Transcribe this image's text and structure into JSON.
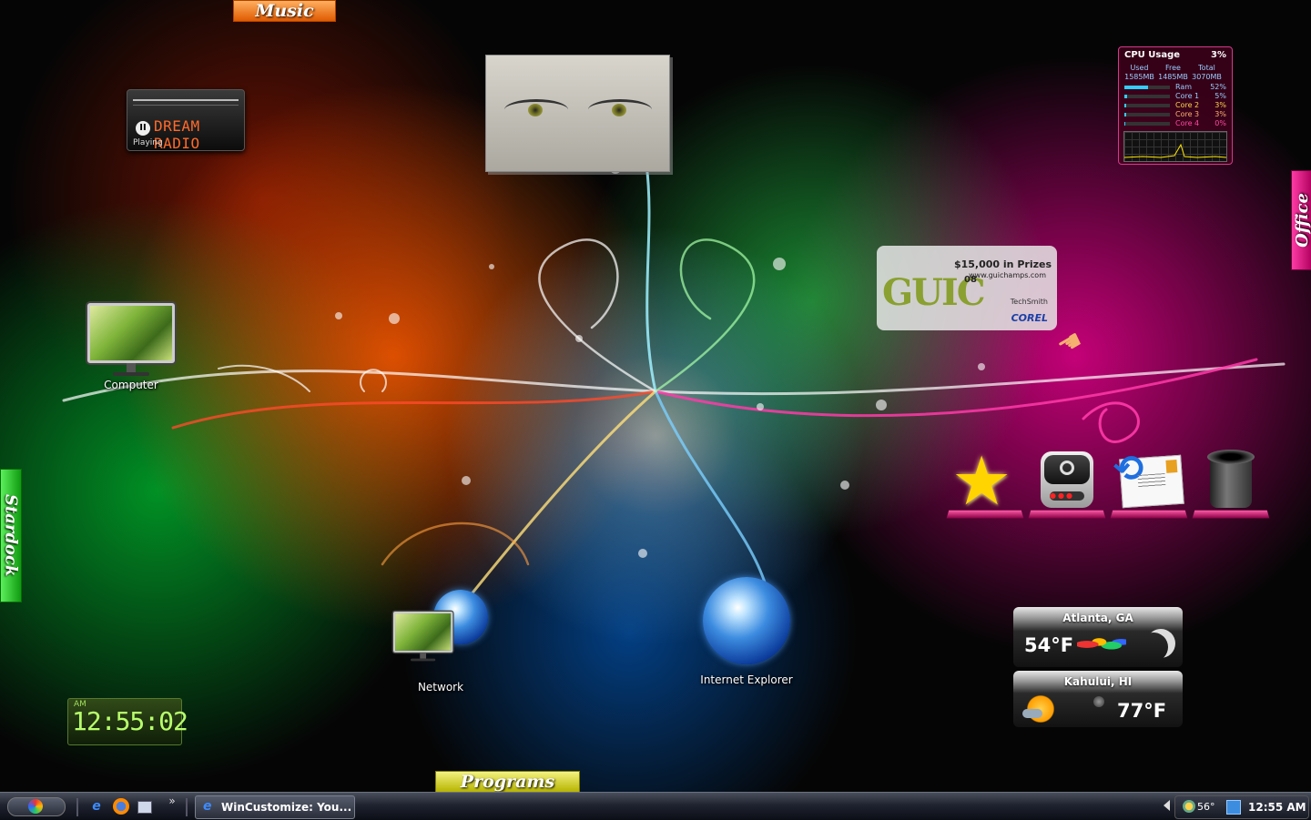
{
  "tabs": {
    "music": "Music",
    "programs": "Programs",
    "stardock": "Stardock",
    "office": "Office"
  },
  "dream_radio": {
    "title": "DREAM RADIO",
    "status": "Playing"
  },
  "cpu_meter": {
    "title": "CPU Usage",
    "total_pct": "3%",
    "col_headers": [
      "Used",
      "Free",
      "Total"
    ],
    "col_values": [
      "1585MB",
      "1485MB",
      "3070MB"
    ],
    "rows": [
      {
        "label": "Ram",
        "value": "52%",
        "level": 0.52
      },
      {
        "label": "Core 1",
        "value": "5%",
        "level": 0.05
      },
      {
        "label": "Core 2",
        "value": "3%",
        "level": 0.03
      },
      {
        "label": "Core 3",
        "value": "3%",
        "level": 0.03
      },
      {
        "label": "Core 4",
        "value": "0%",
        "level": 0.0
      }
    ]
  },
  "ad": {
    "logo": "GUIC",
    "year": "08",
    "prize": "$15,000 in Prizes",
    "url": "www.guichamps.com",
    "sponsor1": "TechSmith",
    "sponsor2": "COREL"
  },
  "desktop_icons": {
    "computer": "Computer",
    "network": "Network",
    "internet_explorer": "Internet Explorer"
  },
  "weather": [
    {
      "city": "Atlanta, GA",
      "temp": "54°F",
      "condition_icon": "moon-icon"
    },
    {
      "city": "Kahului, HI",
      "temp": "77°F",
      "condition_icon": "partly-sunny-icon"
    }
  ],
  "clock": {
    "ampm": "AM",
    "time": "12:55:02"
  },
  "taskbar": {
    "window_label": "WinCustomize: You...",
    "overflow": "»",
    "tray_temp": "56°",
    "tray_time": "12:55 AM"
  },
  "colors": {
    "music_tab": "#e05a00",
    "programs_tab": "#b6b400",
    "stardock_tab": "#109a10",
    "office_tab": "#b0005e",
    "clock_text": "#b8ff6c"
  }
}
